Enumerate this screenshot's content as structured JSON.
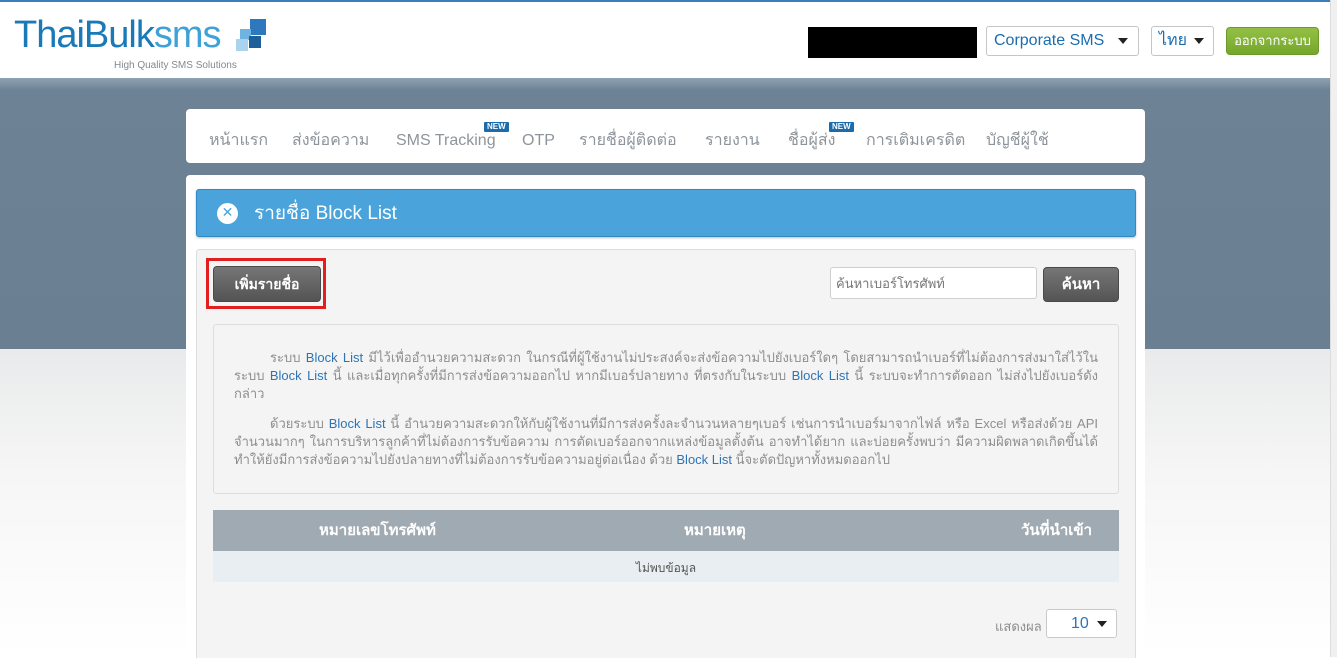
{
  "brand": {
    "logo_main": "ThaiBulk",
    "logo_sms": "sms",
    "tagline": "High Quality SMS Solutions",
    "square_colors": [
      "#2d78bf",
      "#6fb3e3",
      "#a9d3ef",
      "#1f5f99"
    ]
  },
  "header": {
    "account_select": "Corporate SMS",
    "language_select": "ไทย",
    "logout_label": "ออกจากระบบ"
  },
  "nav": {
    "items": [
      {
        "label": "หน้าแรก"
      },
      {
        "label": "ส่งข้อความ"
      },
      {
        "label": "SMS Tracking",
        "badge": "NEW"
      },
      {
        "label": "OTP"
      },
      {
        "label": "รายชื่อผู้ติดต่อ"
      },
      {
        "label": "รายงาน"
      },
      {
        "label": "ชื่อผู้ส่ง",
        "badge": "NEW"
      },
      {
        "label": "การเติมเครดิต"
      },
      {
        "label": "บัญชีผู้ใช้"
      }
    ]
  },
  "page": {
    "title": "รายชื่อ Block List",
    "close_icon": "✕",
    "add_button": "เพิ่มรายชื่อ",
    "search_placeholder": "ค้นหาเบอร์โทรศัพท์",
    "search_button": "ค้นหา"
  },
  "info": {
    "p1": [
      "ระบบ ",
      "Block List",
      " มีไว้เพื่ออำนวยความสะดวก ในกรณีที่ผู้ใช้งานไม่ประสงค์จะส่งข้อความไปยังเบอร์ใดๆ โดยสามารถนำเบอร์ที่ไม่ต้องการส่งมาใส่ไว้ในระบบ ",
      "Block List",
      " นี้ และเมื่อทุกครั้งที่มีการส่งข้อความออกไป หากมีเบอร์ปลายทาง ที่ตรงกับในระบบ ",
      "Block List",
      " นี้ ระบบจะทำการตัดออก ไม่ส่งไปยังเบอร์ดังกล่าว"
    ],
    "p2": [
      "ด้วยระบบ ",
      "Block List",
      " นี้ อำนวยความสะดวกให้กับผู้ใช้งานที่มีการส่งครั้งละจำนวนหลายๆเบอร์ เช่นการนำเบอร์มาจากไฟล์ หรือ Excel หรือส่งด้วย API จำนวนมากๆ ในการบริหารลูกค้าที่ไม่ต้องการรับข้อความ การตัดเบอร์ออกจากแหล่งข้อมูลตั้งต้น อาจทำได้ยาก และบ่อยครั้งพบว่า มีความผิดพลาดเกิดขึ้นได้ ทำให้ยังมีการส่งข้อความไปยังปลายทางที่ไม่ต้องการรับข้อความอยู่ต่อเนื่อง ด้วย ",
      "Block List",
      " นี้จะตัดปัญหาทั้งหมดออกไป"
    ]
  },
  "table": {
    "columns": [
      "หมายเลขโทรศัพท์",
      "หมายเหตุ",
      "วันที่นำเข้า"
    ],
    "empty_text": "ไม่พบข้อมูล"
  },
  "pagination": {
    "show_label": "แสดงผล",
    "page_size": "10"
  }
}
